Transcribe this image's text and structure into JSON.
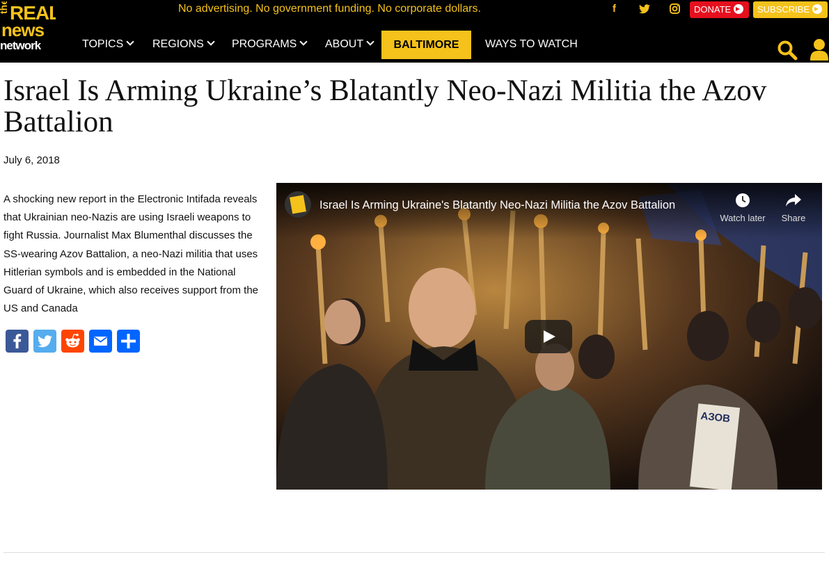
{
  "brand": {
    "logo_line1": "the",
    "logo_line2": "REAL",
    "logo_line3": "news",
    "logo_line4": "network",
    "accent_color": "#f5c21b"
  },
  "topbar": {
    "tagline": "No advertising. No government funding. No corporate dollars.",
    "social_icons": [
      "facebook-icon",
      "twitter-icon",
      "instagram-icon"
    ],
    "donate_label": "DONATE",
    "subscribe_label": "SUBSCRIBE"
  },
  "nav": {
    "items": [
      {
        "label": "TOPICS",
        "has_dropdown": true
      },
      {
        "label": "REGIONS",
        "has_dropdown": true
      },
      {
        "label": "PROGRAMS",
        "has_dropdown": true
      },
      {
        "label": "ABOUT",
        "has_dropdown": true
      },
      {
        "label": "BALTIMORE",
        "highlighted": true
      },
      {
        "label": "WAYS TO WATCH",
        "has_dropdown": false
      }
    ]
  },
  "article": {
    "title": "Israel Is Arming Ukraine’s Blatantly Neo-Nazi Militia the Azov Battalion",
    "date": "July 6, 2018",
    "summary": "A shocking new report in the Electronic Intifada reveals that Ukrainian neo-Nazis are using Israeli weapons to fight Russia. Journalist Max Blumenthal discusses the SS-wearing Azov Battalion, a neo-Nazi militia that uses Hitlerian symbols and is embedded in the National Guard of Ukraine, which also receives support from the US and Canada",
    "share_buttons": [
      {
        "name": "facebook",
        "color": "#3b5998"
      },
      {
        "name": "twitter",
        "color": "#55acee"
      },
      {
        "name": "reddit",
        "color": "#ff4500"
      },
      {
        "name": "email",
        "color": "#0166ff"
      },
      {
        "name": "more",
        "color": "#0166ff"
      }
    ]
  },
  "video": {
    "title": "Israel Is Arming Ukraine's Blatantly Neo-Nazi Militia the Azov Battalion",
    "watch_later_label": "Watch later",
    "share_label": "Share",
    "sign_text": "АЗОВ"
  }
}
